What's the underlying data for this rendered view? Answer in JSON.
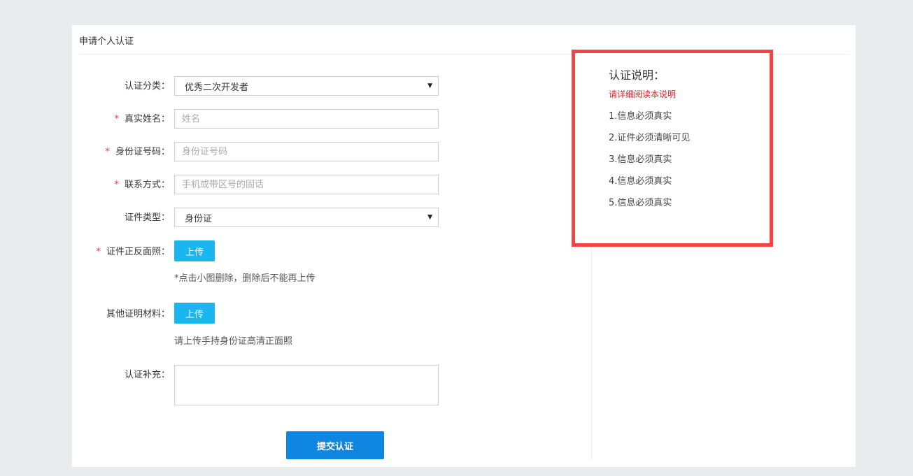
{
  "page": {
    "title": "申请个人认证"
  },
  "form": {
    "category": {
      "label": "认证分类：",
      "value": "优秀二次开发者"
    },
    "real_name": {
      "label": "真实姓名：",
      "placeholder": "姓名",
      "required": "*"
    },
    "id_number": {
      "label": "身份证号码：",
      "placeholder": "身份证号码",
      "required": "*"
    },
    "contact": {
      "label": "联系方式：",
      "placeholder": "手机或带区号的固话",
      "required": "*"
    },
    "doc_type": {
      "label": "证件类型：",
      "value": "身份证"
    },
    "doc_photo": {
      "label": "证件正反面照：",
      "button": "上传",
      "hint": "*点击小图删除，删除后不能再上传",
      "required": "*"
    },
    "other_docs": {
      "label": "其他证明材料：",
      "button": "上传",
      "hint": "请上传手持身份证高清正面照"
    },
    "supplement": {
      "label": "认证补充："
    },
    "submit_label": "提交认证"
  },
  "notes": {
    "title": "认证说明：",
    "subtitle": "请详细阅读本说明",
    "items": [
      "1.信息必须真实",
      "2.证件必须清晰可见",
      "3.信息必须真实",
      "4.信息必须真实",
      "5.信息必须真实"
    ]
  },
  "colors": {
    "accent_upload": "#1bb5ef",
    "accent_submit": "#0f86e0",
    "highlight_border": "#f24444",
    "required": "#e53935"
  },
  "icons": {
    "select_arrow": "caret-down-icon"
  }
}
